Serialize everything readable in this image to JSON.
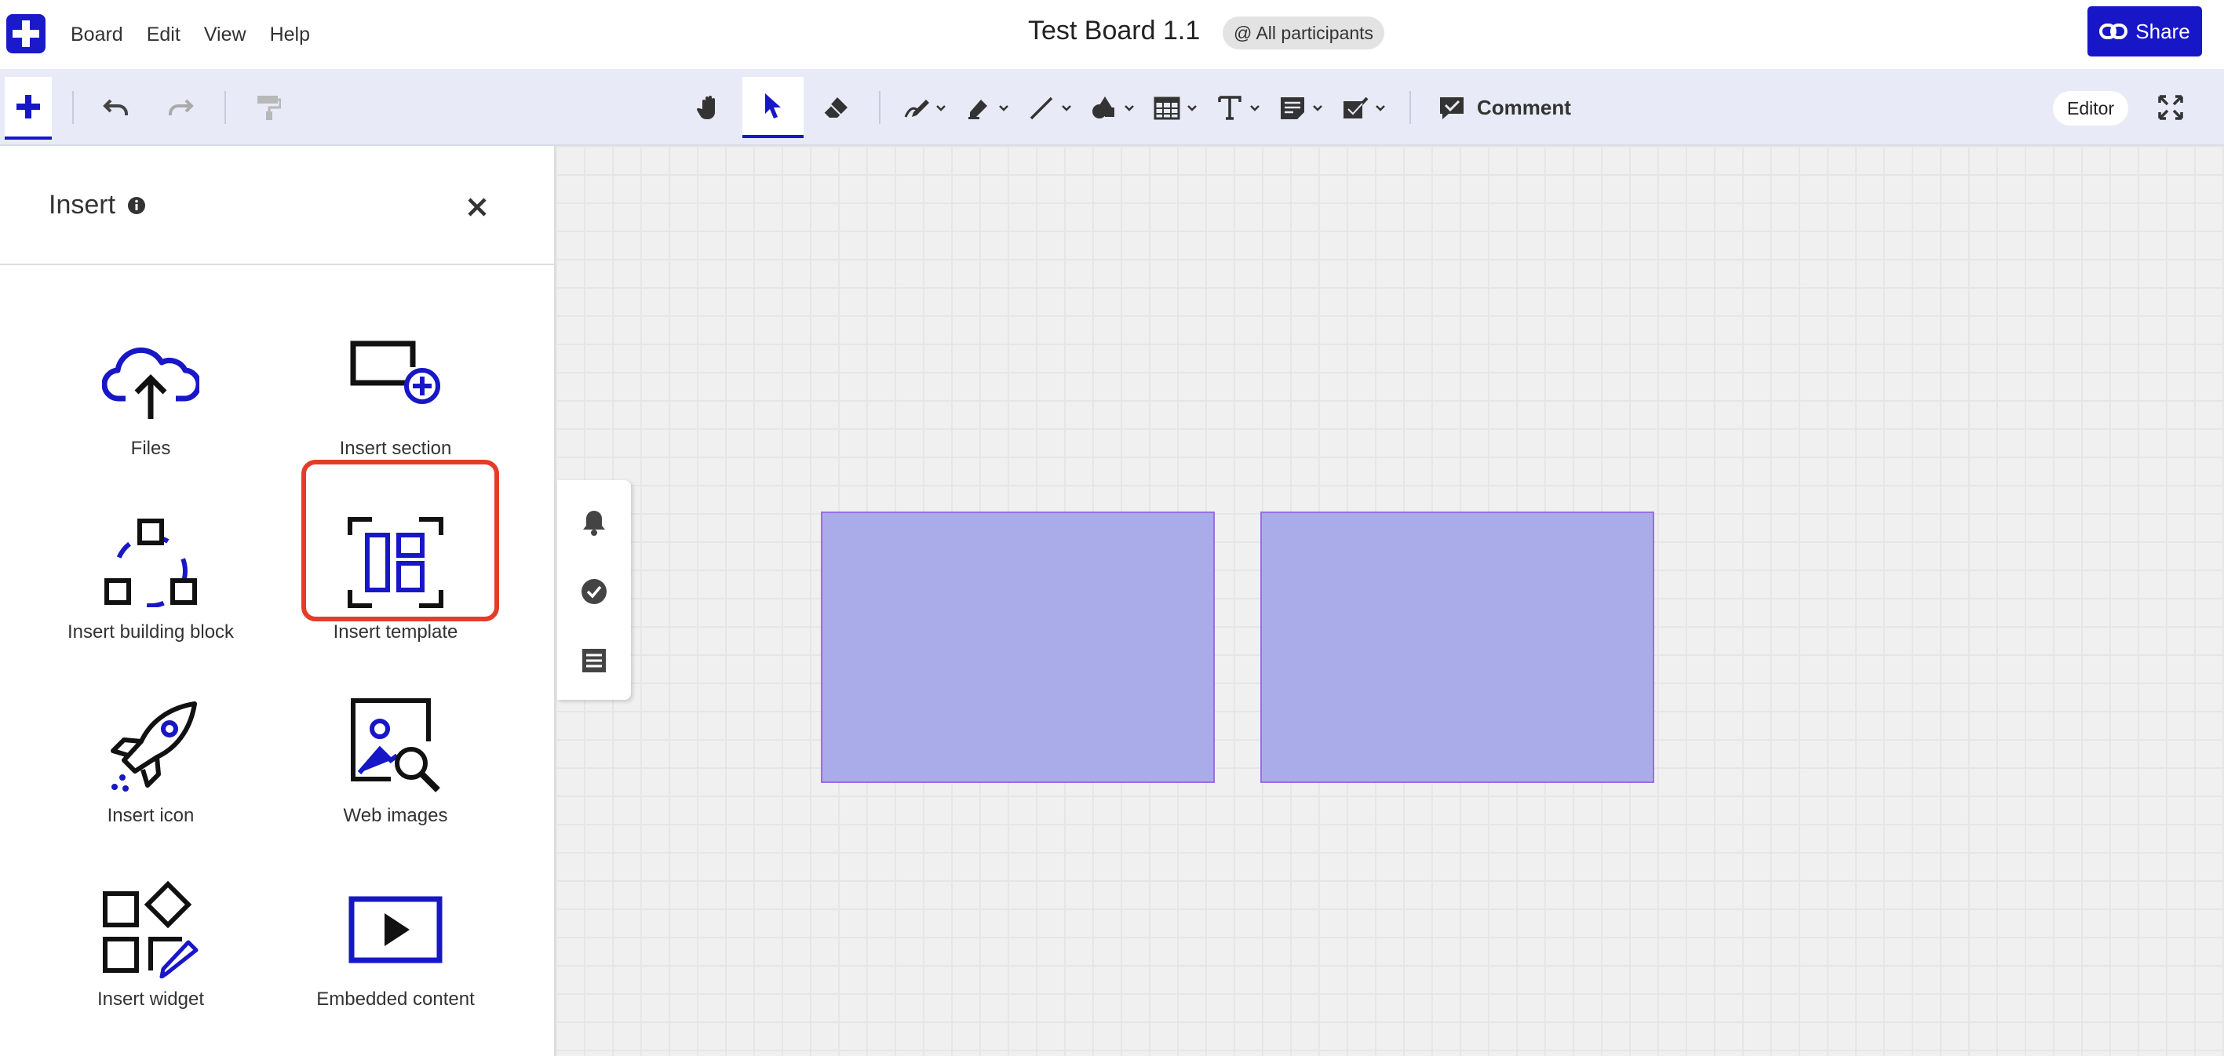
{
  "menu": {
    "items": [
      "Board",
      "Edit",
      "View",
      "Help"
    ]
  },
  "board": {
    "title": "Test Board 1.1",
    "participants_label": "@ All participants"
  },
  "share": {
    "label": "Share"
  },
  "toolbar": {
    "comment_label": "Comment",
    "role_label": "Editor",
    "tools": [
      "hand-icon",
      "pointer-icon",
      "eraser-icon",
      "pen-icon",
      "highlighter-icon",
      "line-icon",
      "shapes-icon",
      "table-icon",
      "text-icon",
      "sticky-note-icon",
      "vote-icon"
    ]
  },
  "panel": {
    "title": "Insert",
    "items": [
      {
        "label": "Files",
        "icon": "cloud-upload-icon"
      },
      {
        "label": "Insert section",
        "icon": "section-add-icon"
      },
      {
        "label": "Insert building block",
        "icon": "building-block-icon"
      },
      {
        "label": "Insert template",
        "icon": "template-icon"
      },
      {
        "label": "Insert icon",
        "icon": "rocket-icon"
      },
      {
        "label": "Web images",
        "icon": "image-search-icon"
      },
      {
        "label": "Insert widget",
        "icon": "widget-icon"
      },
      {
        "label": "Embedded content",
        "icon": "play-icon"
      }
    ]
  },
  "colors": {
    "accent": "#1717c7",
    "highlight": "#e53b28",
    "shape_fill": "#aaacea",
    "shape_border": "#9a6de8"
  }
}
